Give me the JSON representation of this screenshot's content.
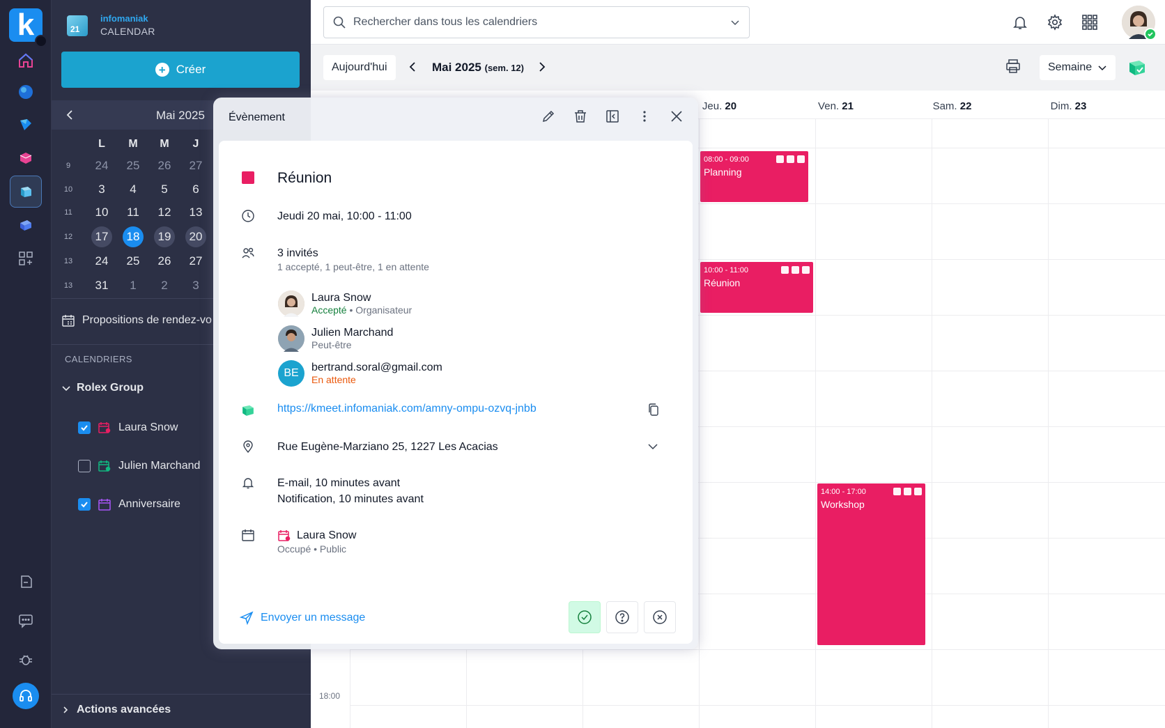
{
  "brand": {
    "name": "infomaniak",
    "app": "CALENDAR",
    "logo_letter": "k",
    "app_icon_text": "21"
  },
  "sidebar": {
    "create_label": "Créer",
    "mini_calendar": {
      "month_label": "Mai 2025",
      "weekdays": [
        "L",
        "M",
        "M",
        "J"
      ],
      "weeks": [
        {
          "num": "9",
          "days": [
            "24",
            "25",
            "26",
            "27"
          ]
        },
        {
          "num": "10",
          "days": [
            "3",
            "4",
            "5",
            "6"
          ]
        },
        {
          "num": "11",
          "days": [
            "10",
            "11",
            "12",
            "13"
          ]
        },
        {
          "num": "12",
          "days": [
            "17",
            "18",
            "19",
            "20"
          ]
        },
        {
          "num": "13",
          "days": [
            "24",
            "25",
            "26",
            "27"
          ]
        },
        {
          "num": "13",
          "days": [
            "31",
            "1",
            "2",
            "3"
          ]
        }
      ]
    },
    "proposals_label": "Propositions de rendez-vo",
    "calendars_header": "CALENDRIERS",
    "group_name": "Rolex Group",
    "calendars": [
      {
        "name": "Laura Snow",
        "checked": true,
        "color": "#e91e63"
      },
      {
        "name": "Julien Marchand",
        "checked": false,
        "color": "#10b981"
      },
      {
        "name": "Anniversaire",
        "checked": true,
        "color": "#a855f7"
      }
    ],
    "advanced_label": "Actions avancées"
  },
  "topbar": {
    "search_placeholder": "Rechercher dans tous les calendriers"
  },
  "toolbar": {
    "today_label": "Aujourd'hui",
    "period_label": "Mai 2025",
    "period_week": "(sem. 12)",
    "view_label": "Semaine"
  },
  "calendar": {
    "day_headers": [
      {
        "day": "Jeu.",
        "num": "20"
      },
      {
        "day": "Ven.",
        "num": "21"
      },
      {
        "day": "Sam.",
        "num": "22"
      },
      {
        "day": "Dim.",
        "num": "23"
      }
    ],
    "time_label": "18:00",
    "events": [
      {
        "time": "08:00 - 09:00",
        "title": "Planning"
      },
      {
        "time": "10:00 - 11:00",
        "title": "Réunion"
      },
      {
        "time": "14:00 - 17:00",
        "title": "Workshop"
      }
    ]
  },
  "popup": {
    "header": "Évènement",
    "title": "Réunion",
    "color": "#e91e63",
    "datetime": "Jeudi 20 mai, 10:00 - 11:00",
    "guests_count": "3 invités",
    "guests_summary": "1 accepté, 1 peut-être, 1 en attente",
    "guests": [
      {
        "name": "Laura Snow",
        "status": "Accepté",
        "role": "Organisateur",
        "initials": ""
      },
      {
        "name": "Julien Marchand",
        "status": "Peut-être",
        "role": "",
        "initials": ""
      },
      {
        "name": "bertrand.soral@gmail.com",
        "status": "En attente",
        "role": "",
        "initials": "BE"
      }
    ],
    "role_separator": "•",
    "meet_link": "https://kmeet.infomaniak.com/amny-ompu-ozvq-jnbb",
    "location": "Rue Eugène-Marziano 25, 1227 Les Acacias",
    "reminders": [
      "E-mail, 10 minutes avant",
      "Notification, 10 minutes avant"
    ],
    "calendar_name": "Laura Snow",
    "calendar_meta": "Occupé • Public",
    "send_label": "Envoyer un message"
  }
}
